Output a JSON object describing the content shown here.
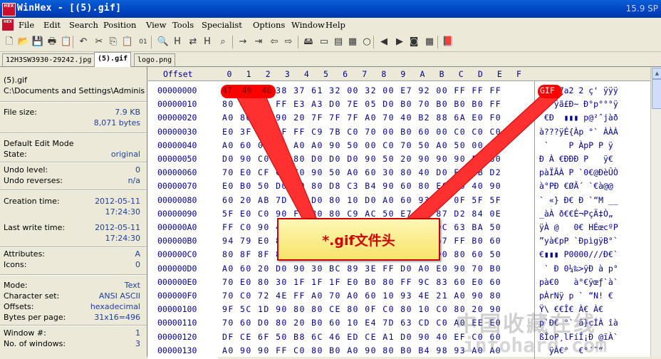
{
  "window": {
    "title": "WinHex - [(5).gif]",
    "right_text": "15.9 SP",
    "icon_text": "HEX"
  },
  "menu": [
    {
      "label": "File"
    },
    {
      "label": "Edit"
    },
    {
      "label": "Search"
    },
    {
      "label": "Position"
    },
    {
      "label": "View"
    },
    {
      "label": "Tools"
    },
    {
      "label": "Specialist"
    },
    {
      "label": "Options"
    },
    {
      "label": "Window"
    },
    {
      "label": "Help"
    }
  ],
  "toolbar_icons": [
    "new-icon",
    "open-icon",
    "save-icon",
    "print-icon",
    "properties-icon",
    "undo-icon",
    "cut-icon",
    "copy-icon",
    "paste-icon",
    "binary-icon",
    "find-icon",
    "find-hex-icon",
    "replace-icon",
    "replace-hex-icon",
    "binoculars-icon",
    "goto-icon",
    "goto-offset-icon",
    "back-icon",
    "forward-icon",
    "disk-icon",
    "ram-icon",
    "tape-icon",
    "calculator-icon",
    "search-icon",
    "prev-icon",
    "next-icon",
    "camera-icon",
    "grid-icon",
    "book-icon"
  ],
  "tabs": [
    {
      "label": "12H3SW3930-29242.jpg"
    },
    {
      "label": "(5).gif"
    },
    {
      "label": "logo.png"
    }
  ],
  "info": {
    "filename": "(5).gif",
    "path": "C:\\Documents and Settings\\Adminis",
    "file_size_label": "File size:",
    "file_size_kb": "7.9 KB",
    "file_size_bytes": "8,071 bytes",
    "edit_mode_label": "Default Edit Mode",
    "state_label": "State:",
    "state_value": "original",
    "undo_level_label": "Undo level:",
    "undo_level_value": "0",
    "undo_reverses_label": "Undo reverses:",
    "undo_reverses_value": "n/a",
    "creation_label": "Creation time:",
    "creation_date": "2012-05-11",
    "creation_time": "17:24:30",
    "lastwrite_label": "Last write time:",
    "lastwrite_date": "2012-05-11",
    "lastwrite_time": "17:24:30",
    "attributes_label": "Attributes:",
    "attributes_value": "A",
    "icons_label": "Icons:",
    "icons_value": "0",
    "mode_label": "Mode:",
    "mode_value": "Text",
    "charset_label": "Character set:",
    "charset_value": "ANSI ASCII",
    "offsets_label": "Offsets:",
    "offsets_value": "hexadecimal",
    "bpp_label": "Bytes per page:",
    "bpp_value": "31x16=496",
    "window_num_label": "Window #:",
    "window_num_value": "1",
    "windows_label": "No. of windows:",
    "windows_value": "3"
  },
  "hex": {
    "offset_header": "Offset",
    "columns": [
      "0",
      "1",
      "2",
      "3",
      "4",
      "5",
      "6",
      "7",
      "8",
      "9",
      "A",
      "B",
      "C",
      "D",
      "E",
      "F"
    ],
    "rows": [
      {
        "offset": "00000000",
        "bytes": "47 49 46 38 37 61 32 00 32 00 E7 92 00 FF FF FF",
        "text": "GIF87a2 2 ç' ÿÿÿ"
      },
      {
        "offset": "00000010",
        "bytes": "80 40 10 FF E3 A3 D0 7E 05 D0 B0 70 B0 B0 B0 FF",
        "text": "€@ ÿã£Ð~ Ð°p°°°ÿ"
      },
      {
        "offset": "00000020",
        "bytes": "A0 80 D0 90 20 7F 7F 7F A0 70 40 B2 88 6A E0 F0",
        "text": " €Ð  ▮▮▮ p@²ˆjàð"
      },
      {
        "offset": "00000030",
        "bytes": "E0 3F 3F 3F FF C9 7B C0 70 00 B0 60 00 C0 C0 C0",
        "text": "à???ÿÉ{Àp °` ÀÀÀ"
      },
      {
        "offset": "00000040",
        "bytes": "A0 60 00 A0 A0 A0 90 50 00 C0 70 50 A0 50 00 FF",
        "text": " `    P ÀpP P ÿ"
      },
      {
        "offset": "00000050",
        "bytes": "D0 90 C0 A0 80 D0 D0 D0 90 50 20 90 90 90 FF 80",
        "text": "Ð À €ÐÐÐ P   ÿ€"
      },
      {
        "offset": "00000060",
        "bytes": "70 E0 CF C3 C0 90 50 A0 60 30 80 40 D0 E8 DB D2",
        "text": "pàÏÃÀ P `0€@ÐèÛÒ"
      },
      {
        "offset": "00000070",
        "bytes": "E0 B0 50 D0 A0 80 D8 C3 B4 90 60 80 E0 40 40 90",
        "text": "à°PÐ €ØÃ´ `€à@@ "
      },
      {
        "offset": "00000080",
        "bytes": "60 20 AB 7D 10 D0 80 10 D0 A0 60 93 4D 0F 5F 5F",
        "text": "` «} Ð€ Ð `“M __"
      },
      {
        "offset": "00000090",
        "bytes": "5F E0 C0 90 F0 80 80 C9 AC 50 E7 C4 87 D2 84 0E",
        "text": "_àÀ ð€€É¬PçÄ‡Ò„ "
      },
      {
        "offset": "000000A0",
        "bytes": "FF C0 90 40 10 10 90 30 80 20 48 C9 9C 63 BA 50",
        "text": "ÿÀ @   0€ HÉœcºP"
      },
      {
        "offset": "000000B0",
        "bytes": "94 79 E0 80 70 50 A0 60 D0 70 EC BD 67 FF B0 60",
        "text": "”yà€pP `ÐpìgÿB°`"
      },
      {
        "offset": "000000C0",
        "bytes": "80 8F 8F 8F 00 00 60 50 3F 3F 2F 2F D0 80 60 50",
        "text": "€▮▮▮ P0000///Ð€`"
      },
      {
        "offset": "000000D0",
        "bytes": "A0 60 20 D0 90 30 BC 89 3E FF D0 A0 E0 90 70 B0",
        "text": " ` Ð 0¼‰>ÿÐ à p°"
      },
      {
        "offset": "000000E0",
        "bytes": "70 E0 80 30 1F 1F 1F E0 B0 80 FF 9C 83 60 E0 60",
        "text": "pà€0   à°€ÿœƒ`à`"
      },
      {
        "offset": "000000F0",
        "bytes": "70 C0 72 4E FF A0 70 A0 60 10 93 4E 21 A0 90 80",
        "text": "pÀrNÿ p ` “N! €"
      },
      {
        "offset": "00000100",
        "bytes": "9F 5C 1D 90 80 80 CE 80 0F C0 80 10 C0 80 20 90",
        "text": "Ÿ\\ €€Î€ À€ À€  "
      },
      {
        "offset": "00000110",
        "bytes": "70 60 D0 80 20 B0 60 10 E4 7D 63 CD C0 A0 EE E0",
        "text": "p`Ð€ °` ä}cÍÀ îà"
      },
      {
        "offset": "00000120",
        "bytes": "DF CE 6F 50 B8 6C 46 ED CE A1 D0 90 40 EF C0 60",
        "text": "ßÎoP¸lFíÎ¡Ð @ïÀ`"
      },
      {
        "offset": "00000130",
        "bytes": "A0 90 90 FF C0 80 B0 A0 90 80 B0 B4 98 93 A0 A0",
        "text": "  ÿÀ€°  €°´˜“  "
      }
    ]
  },
  "callout": {
    "text": "*.gif文件头"
  },
  "watermark": {
    "line1": "中国收藏在线",
    "line2": "intohard.com"
  },
  "colors": {
    "highlight": "#ff0000",
    "callout_text": "#d00000",
    "hex_text": "#00008C"
  }
}
